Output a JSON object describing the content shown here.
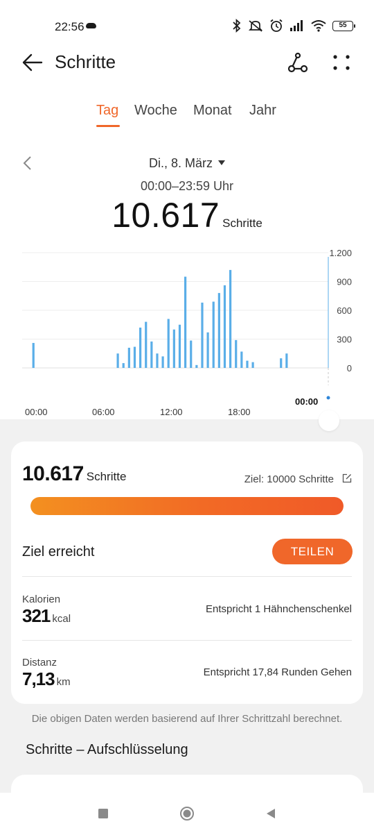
{
  "status_bar": {
    "time": "22:56",
    "battery": "55"
  },
  "header": {
    "title": "Schritte"
  },
  "tabs": [
    {
      "label": "Tag",
      "active": true
    },
    {
      "label": "Woche",
      "active": false
    },
    {
      "label": "Monat",
      "active": false
    },
    {
      "label": "Jahr",
      "active": false
    }
  ],
  "date": {
    "label": "Di., 8. März",
    "range": "00:00–23:59 Uhr"
  },
  "summary": {
    "steps": "10.617",
    "unit": "Schritte"
  },
  "colors": {
    "accent": "#f0672a",
    "bar": "#5aaee8"
  },
  "chart_data": {
    "type": "bar",
    "x_ticks": [
      "00:00",
      "06:00",
      "12:00",
      "18:00"
    ],
    "y_ticks": [
      "1.200",
      "900",
      "600",
      "300",
      "0"
    ],
    "ylim": [
      0,
      1200
    ],
    "current_marker": "00:00",
    "x_unit_hours": true,
    "bars": [
      {
        "hour": 0.5,
        "value": 260
      },
      {
        "hour": 8.0,
        "value": 150
      },
      {
        "hour": 8.5,
        "value": 50
      },
      {
        "hour": 9.0,
        "value": 210
      },
      {
        "hour": 9.5,
        "value": 220
      },
      {
        "hour": 10.0,
        "value": 420
      },
      {
        "hour": 10.5,
        "value": 480
      },
      {
        "hour": 11.0,
        "value": 275
      },
      {
        "hour": 11.5,
        "value": 150
      },
      {
        "hour": 12.0,
        "value": 120
      },
      {
        "hour": 12.5,
        "value": 510
      },
      {
        "hour": 13.0,
        "value": 400
      },
      {
        "hour": 13.5,
        "value": 450
      },
      {
        "hour": 14.0,
        "value": 950
      },
      {
        "hour": 14.5,
        "value": 285
      },
      {
        "hour": 15.0,
        "value": 30
      },
      {
        "hour": 15.5,
        "value": 680
      },
      {
        "hour": 16.0,
        "value": 370
      },
      {
        "hour": 16.5,
        "value": 690
      },
      {
        "hour": 17.0,
        "value": 780
      },
      {
        "hour": 17.5,
        "value": 860
      },
      {
        "hour": 18.0,
        "value": 1020
      },
      {
        "hour": 18.5,
        "value": 290
      },
      {
        "hour": 19.0,
        "value": 170
      },
      {
        "hour": 19.5,
        "value": 75
      },
      {
        "hour": 20.0,
        "value": 60
      },
      {
        "hour": 22.5,
        "value": 100
      },
      {
        "hour": 23.0,
        "value": 150
      }
    ]
  },
  "goal_card": {
    "steps": "10.617",
    "unit": "Schritte",
    "goal_label": "Ziel: 10000 Schritte",
    "progress_fraction": 1.0,
    "status": "Ziel erreicht",
    "share_label": "TEILEN"
  },
  "metrics": [
    {
      "label": "Kalorien",
      "value": "321",
      "unit": "kcal",
      "equivalent": "Entspricht 1 Hähnchenschenkel"
    },
    {
      "label": "Distanz",
      "value": "7,13",
      "unit": "km",
      "equivalent": "Entspricht 17,84 Runden Gehen"
    }
  ],
  "footnote": "Die obigen Daten werden basierend auf Ihrer Schrittzahl berechnet.",
  "breakdown_title": "Schritte – Aufschlüsselung"
}
